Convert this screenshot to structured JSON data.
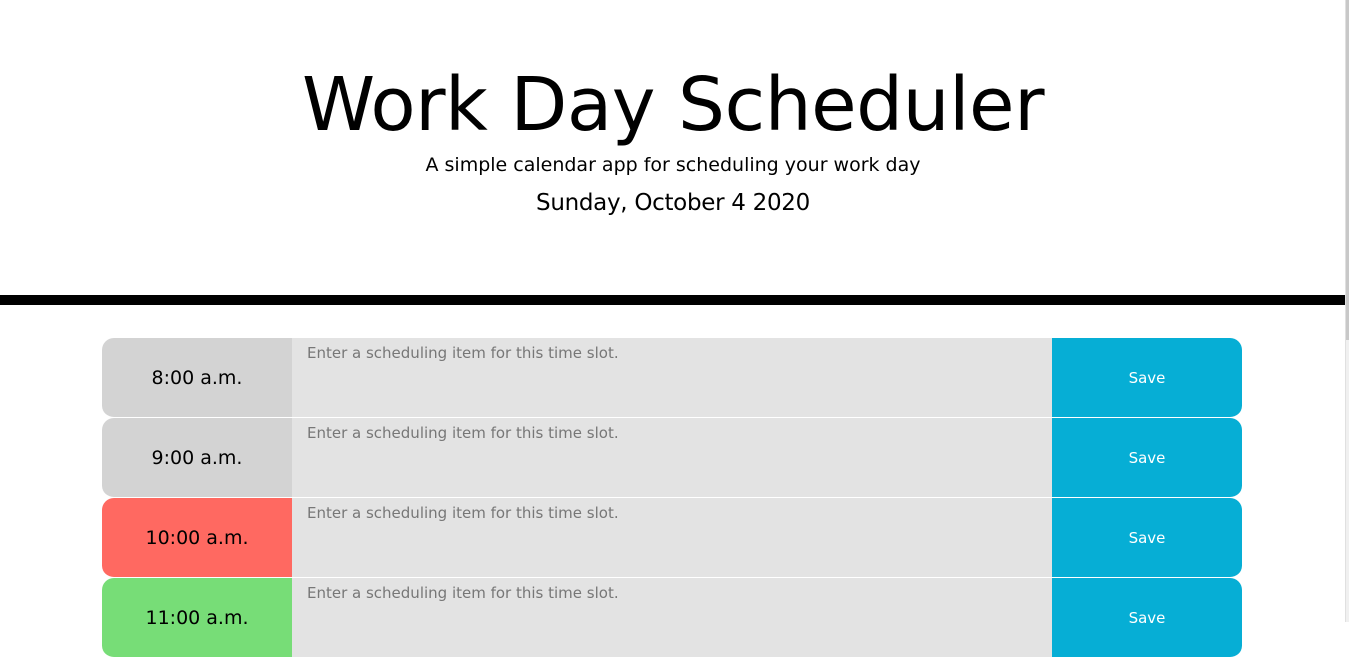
{
  "header": {
    "title": "Work Day Scheduler",
    "lead": "A simple calendar app for scheduling your work day",
    "current_day": "Sunday, October 4 2020"
  },
  "colors": {
    "past": "#d3d3d3",
    "present": "#ff6961",
    "future": "#77dd77",
    "save_button": "#06aed5",
    "textarea_bg": "#e3e3e3"
  },
  "time_blocks": [
    {
      "hour": "8:00 a.m.",
      "state": "past",
      "placeholder": "Enter a scheduling item for this time slot.",
      "value": "",
      "save_label": "Save"
    },
    {
      "hour": "9:00 a.m.",
      "state": "past",
      "placeholder": "Enter a scheduling item for this time slot.",
      "value": "",
      "save_label": "Save"
    },
    {
      "hour": "10:00 a.m.",
      "state": "present",
      "placeholder": "Enter a scheduling item for this time slot.",
      "value": "",
      "save_label": "Save"
    },
    {
      "hour": "11:00 a.m.",
      "state": "future",
      "placeholder": "Enter a scheduling item for this time slot.",
      "value": "",
      "save_label": "Save"
    }
  ]
}
